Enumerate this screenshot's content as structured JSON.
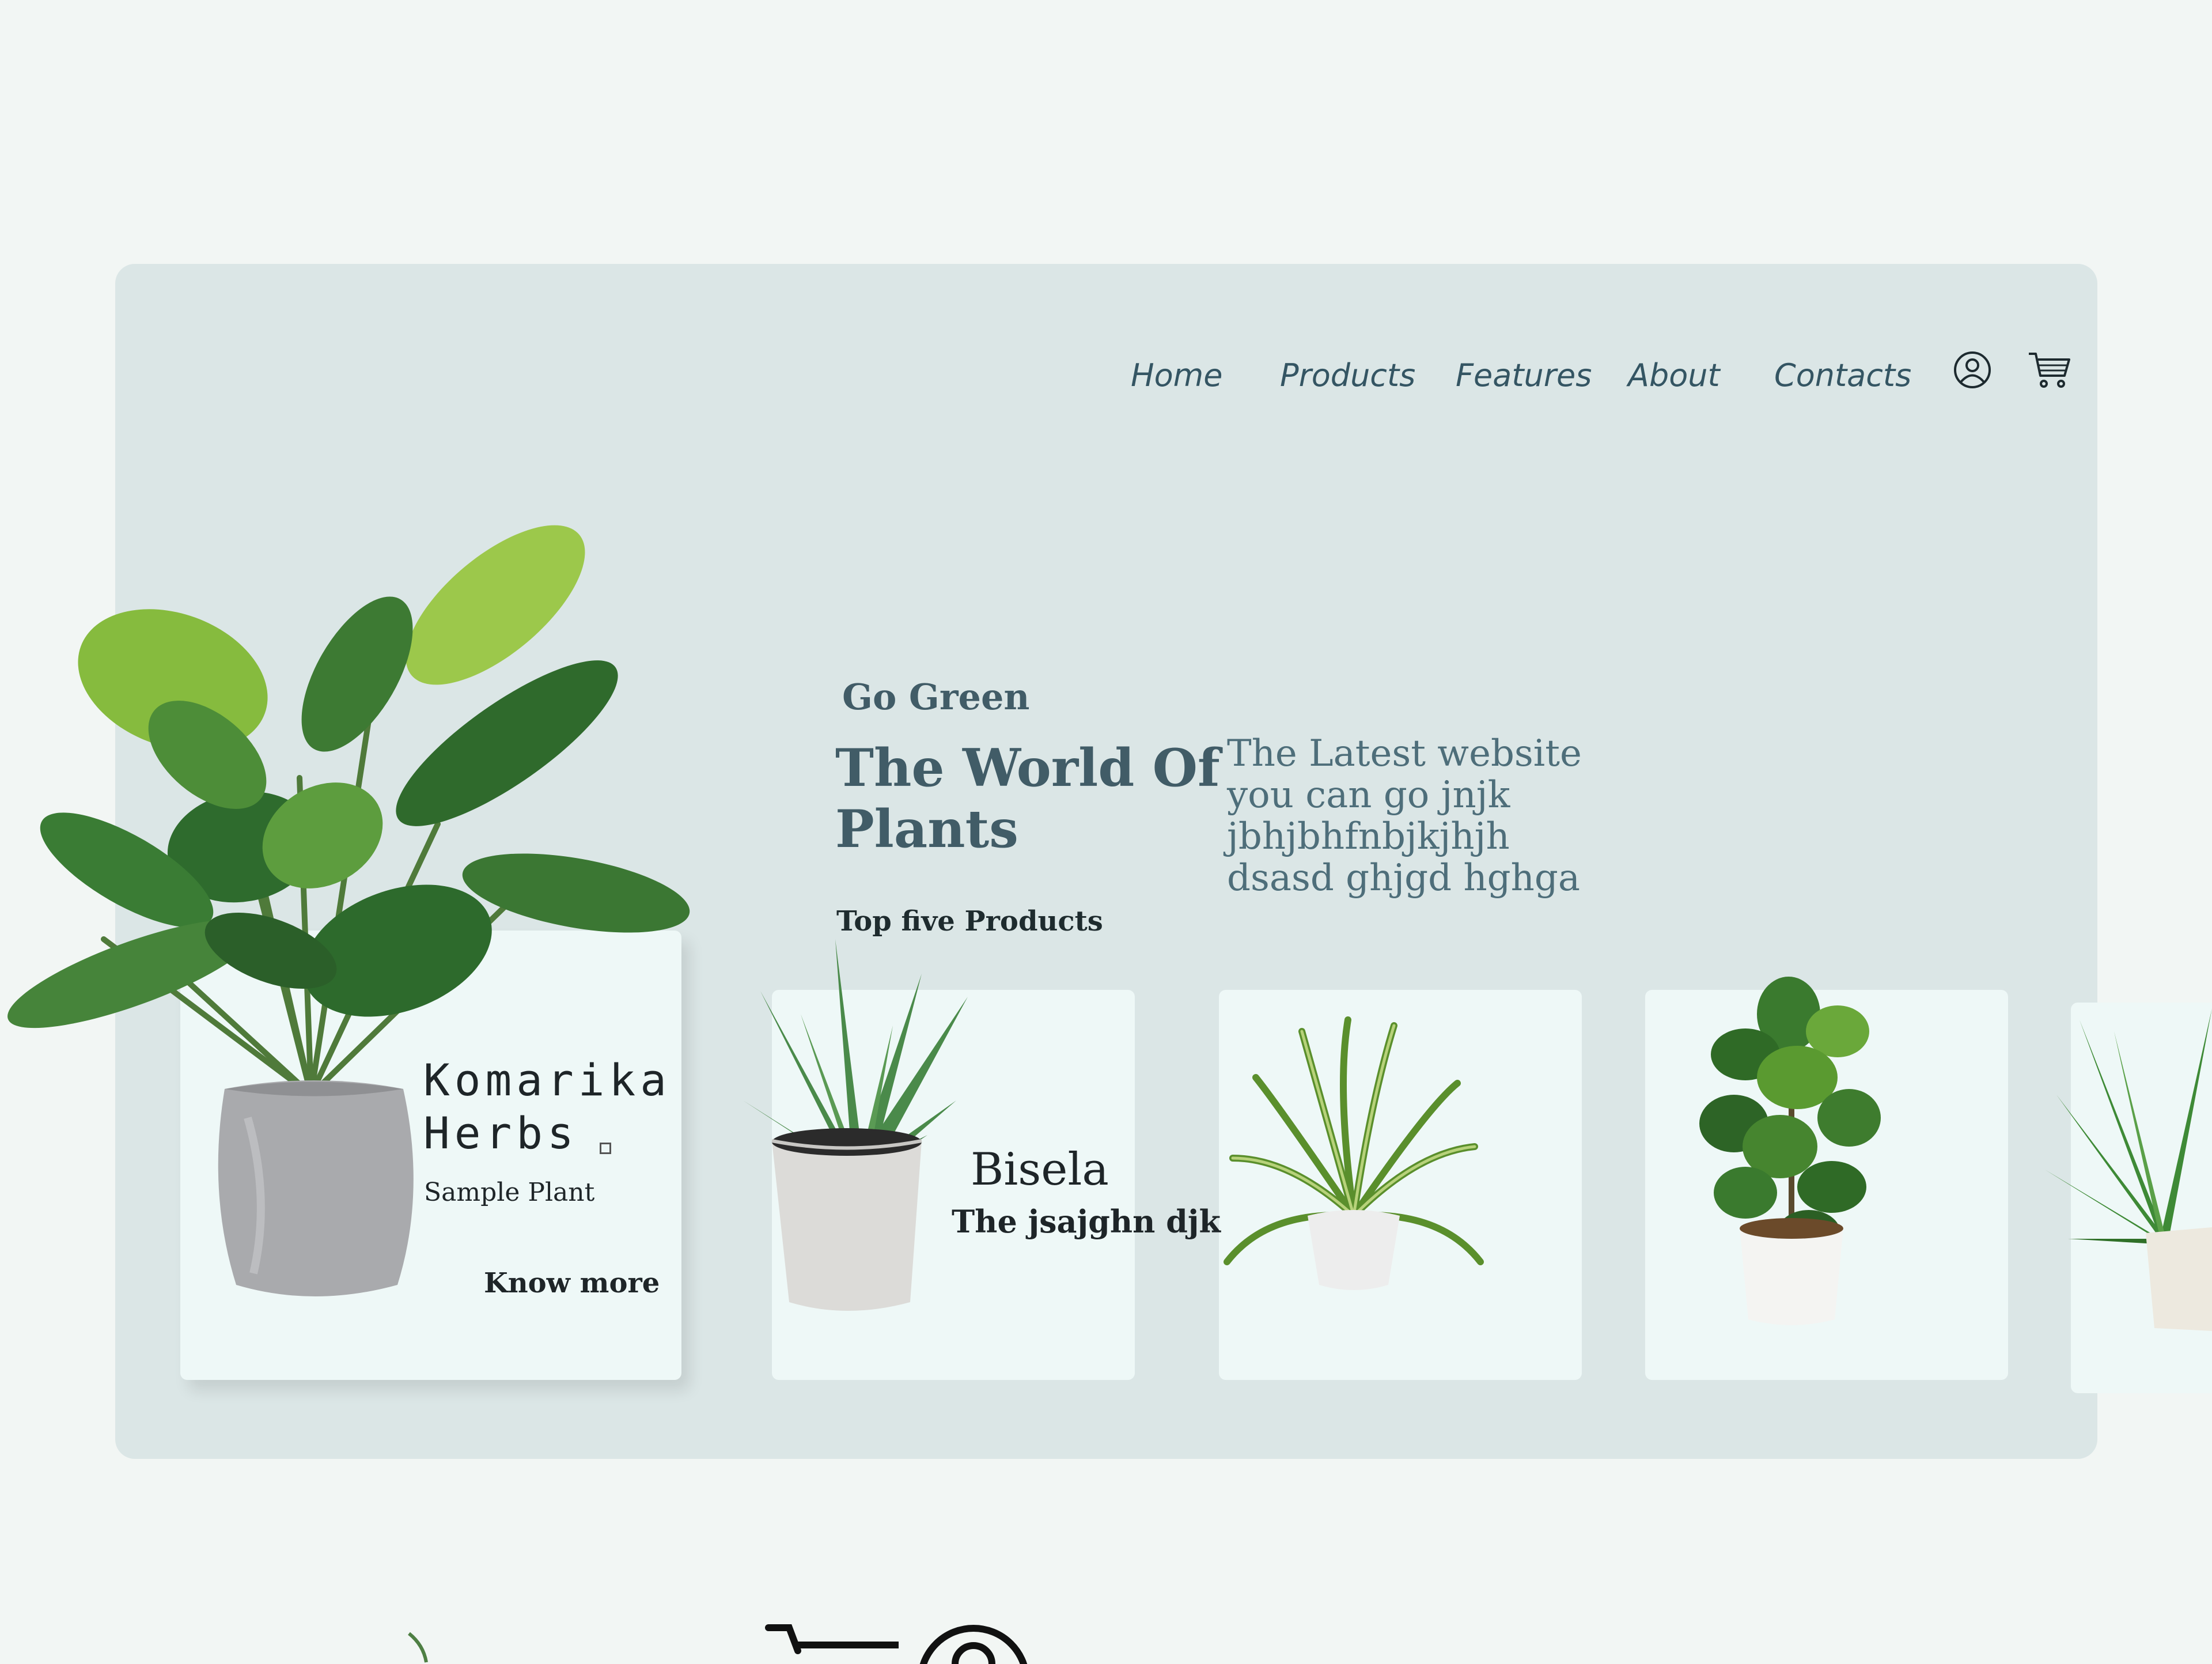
{
  "nav": {
    "items": [
      {
        "label": "Home"
      },
      {
        "label": "Products"
      },
      {
        "label": "Features"
      },
      {
        "label": "About"
      },
      {
        "label": "Contacts"
      }
    ],
    "icons": [
      "user-icon",
      "cart-icon"
    ]
  },
  "hero": {
    "eyebrow": "Go Green",
    "title_line1": "The World Of",
    "title_line2": "Plants",
    "desc_line1": "The Latest website",
    "desc_line2": "you can go jnjk",
    "desc_line3": "jbhjbhfnbjkjhjh",
    "desc_line4": "dsasd  ghjgd hghga",
    "section_label": "Top five Products"
  },
  "featured": {
    "name_line1": "Komarika",
    "name_line2": "Herbs",
    "subtitle": "Sample Plant",
    "cta": "Know more"
  },
  "card2": {
    "name": "Bisela",
    "desc": "The jsajghn djk"
  },
  "colors": {
    "page_bg": "#f2f6f4",
    "hero_bg": "#dbe6e6",
    "card_bg": "#eef8f7",
    "nav_text": "#345563",
    "heading": "#415c67"
  }
}
